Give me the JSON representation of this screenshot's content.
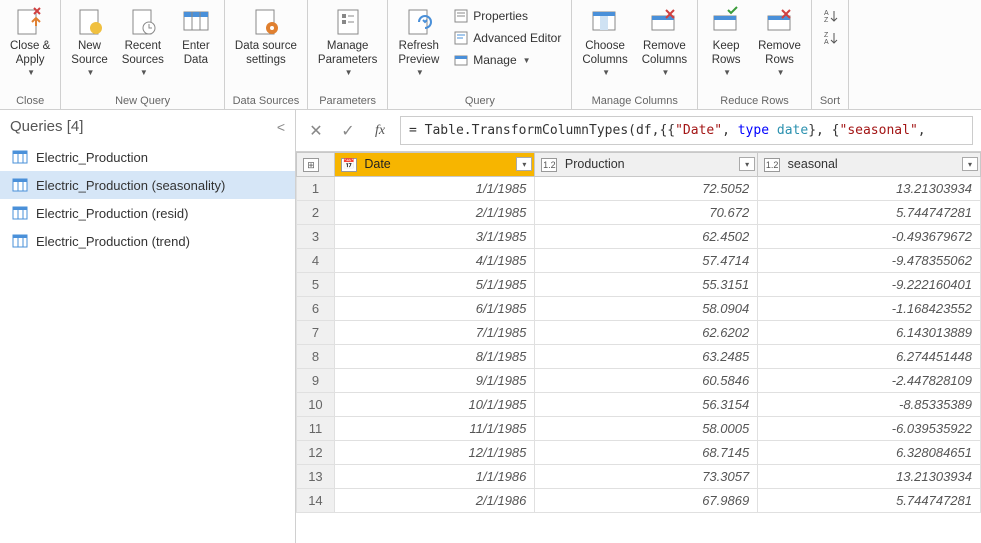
{
  "ribbon": {
    "close": {
      "close_apply": "Close &\nApply",
      "group": "Close"
    },
    "newquery": {
      "new_source": "New\nSource",
      "recent_sources": "Recent\nSources",
      "enter_data": "Enter\nData",
      "group": "New Query"
    },
    "datasources": {
      "settings": "Data source\nsettings",
      "group": "Data Sources"
    },
    "parameters": {
      "manage": "Manage\nParameters",
      "group": "Parameters"
    },
    "query": {
      "refresh": "Refresh\nPreview",
      "properties": "Properties",
      "advanced": "Advanced Editor",
      "manage": "Manage",
      "group": "Query"
    },
    "managecols": {
      "choose": "Choose\nColumns",
      "remove": "Remove\nColumns",
      "group": "Manage Columns"
    },
    "reducerows": {
      "keep": "Keep\nRows",
      "remove": "Remove\nRows",
      "group": "Reduce Rows"
    },
    "sort": {
      "group": "Sort"
    }
  },
  "queries": {
    "title": "Queries [4]",
    "items": [
      {
        "name": "Electric_Production"
      },
      {
        "name": "Electric_Production (seasonality)"
      },
      {
        "name": "Electric_Production (resid)"
      },
      {
        "name": "Electric_Production (trend)"
      }
    ]
  },
  "formula": {
    "prefix": "= Table.TransformColumnTypes(df,{{",
    "str1": "\"Date\"",
    "comma1": ", ",
    "kw": "type",
    "sp": " ",
    "type": "date",
    "mid": "}, {",
    "str2": "\"seasonal\"",
    "tail": ","
  },
  "columns": {
    "date": "Date",
    "production": "Production",
    "seasonal": "seasonal"
  },
  "type_labels": {
    "num": "1.2"
  },
  "rows": [
    {
      "n": "1",
      "date": "1/1/1985",
      "prod": "72.5052",
      "seas": "13.21303934"
    },
    {
      "n": "2",
      "date": "2/1/1985",
      "prod": "70.672",
      "seas": "5.744747281"
    },
    {
      "n": "3",
      "date": "3/1/1985",
      "prod": "62.4502",
      "seas": "-0.493679672"
    },
    {
      "n": "4",
      "date": "4/1/1985",
      "prod": "57.4714",
      "seas": "-9.478355062"
    },
    {
      "n": "5",
      "date": "5/1/1985",
      "prod": "55.3151",
      "seas": "-9.222160401"
    },
    {
      "n": "6",
      "date": "6/1/1985",
      "prod": "58.0904",
      "seas": "-1.168423552"
    },
    {
      "n": "7",
      "date": "7/1/1985",
      "prod": "62.6202",
      "seas": "6.143013889"
    },
    {
      "n": "8",
      "date": "8/1/1985",
      "prod": "63.2485",
      "seas": "6.274451448"
    },
    {
      "n": "9",
      "date": "9/1/1985",
      "prod": "60.5846",
      "seas": "-2.447828109"
    },
    {
      "n": "10",
      "date": "10/1/1985",
      "prod": "56.3154",
      "seas": "-8.85335389"
    },
    {
      "n": "11",
      "date": "11/1/1985",
      "prod": "58.0005",
      "seas": "-6.039535922"
    },
    {
      "n": "12",
      "date": "12/1/1985",
      "prod": "68.7145",
      "seas": "6.328084651"
    },
    {
      "n": "13",
      "date": "1/1/1986",
      "prod": "73.3057",
      "seas": "13.21303934"
    },
    {
      "n": "14",
      "date": "2/1/1986",
      "prod": "67.9869",
      "seas": "5.744747281"
    }
  ]
}
